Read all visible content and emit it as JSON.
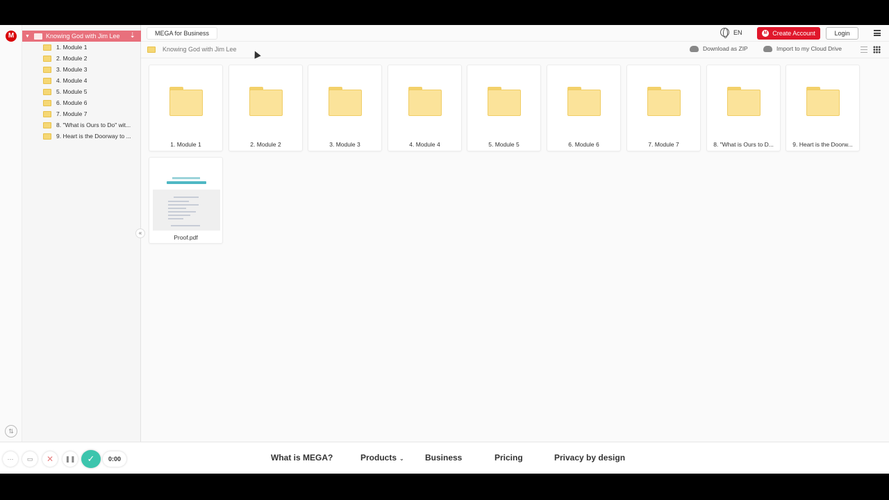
{
  "colors": {
    "accent_red": "#e0172b",
    "tree_selected": "#e8707c",
    "folder_yellow": "#fbe39a",
    "record_done": "#3cc5ad"
  },
  "topbar": {
    "business_tab": "MEGA for Business",
    "language": "EN",
    "create_account": "Create Account",
    "login": "Login"
  },
  "subbar": {
    "breadcrumb": "Knowing God with Jim Lee",
    "download_zip": "Download as ZIP",
    "import_drive": "Import to my Cloud Drive"
  },
  "tree": {
    "root": "Knowing God with Jim Lee",
    "items": [
      "1. Module 1",
      "2. Module 2",
      "3. Module 3",
      "4. Module 4",
      "5. Module 5",
      "6. Module 6",
      "7. Module 7",
      "8. \"What is Ours to Do\" wit...",
      "9. Heart is the Doorway to ..."
    ]
  },
  "grid": {
    "folders": [
      "1. Module 1",
      "2. Module 2",
      "3. Module 3",
      "4. Module 4",
      "5. Module 5",
      "6. Module 6",
      "7. Module 7",
      "8. \"What is Ours to D...",
      "9. Heart is the Doorw..."
    ],
    "file": "Proof.pdf"
  },
  "footer": {
    "what": "What is MEGA?",
    "products": "Products",
    "business": "Business",
    "pricing": "Pricing",
    "privacy": "Privacy by design"
  },
  "recorder": {
    "more": "···",
    "cancel": "✕",
    "pause": "❚❚",
    "done": "✓",
    "time": "0:00"
  },
  "icons": {
    "logo": "mega-logo-icon",
    "globe": "globe-icon",
    "cloud": "cloud-download-icon",
    "menu": "hamburger-menu-icon",
    "list": "list-view-icon",
    "grid": "grid-view-icon",
    "collapse": "collapse-chevron-icon"
  }
}
